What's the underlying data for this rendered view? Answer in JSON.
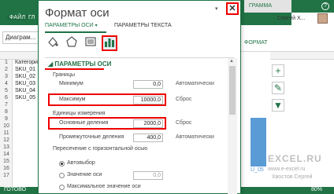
{
  "excel": {
    "file_tab": "ФАЙЛ",
    "home_tab_fragment": "ГЛ",
    "context_tab_fragment": "ГРАММА",
    "format_tab": "ФОРМАТ",
    "user_name": "Сергей Х...",
    "name_box": "Диаграм...",
    "rows": [
      "1",
      "2",
      "3",
      "4",
      "5",
      "6",
      "7",
      "8",
      "9",
      "10",
      "11",
      "12",
      "13",
      "14",
      "15",
      "16",
      "17"
    ],
    "cells": [
      "Категория",
      "SKU_01",
      "SKU_02",
      "SKU_03",
      "SKU_04",
      "SKU_05"
    ],
    "chart_label_fragment": "U_05",
    "watermark": "EXCEL.RU",
    "watermark_url": "www.e-excel.ru",
    "watermark_name": "Хвостов Сергей",
    "zoom": "80%",
    "ready": "ГОТОВО"
  },
  "dialog": {
    "title": "Формат оси",
    "close_glyph": "✕",
    "tabs": [
      {
        "label": "ПАРАМЕТРЫ ОСИ",
        "active": true
      },
      {
        "label": "ПАРАМЕТРЫ ТЕКСТА",
        "active": false
      }
    ],
    "icons": [
      "fill-line-icon",
      "effects-icon",
      "size-properties-icon",
      "axis-options-icon"
    ],
    "section_title": "ПАРАМЕТРЫ ОСИ",
    "bounds_label": "Границы",
    "minimum": {
      "label": "Минимум",
      "value": "0,0",
      "mode": "Автоматически"
    },
    "maximum": {
      "label": "Максимум",
      "value": "10000,0",
      "mode": "Сброс"
    },
    "units_label": "Единицы измерения",
    "major": {
      "label": "Основные деления",
      "value": "2000,0",
      "mode": "Сброс"
    },
    "minor": {
      "label": "Промежуточные деления",
      "value": "400,0",
      "mode": "Автоматически"
    },
    "cross_label": "Пересечение с горизонтальной осью",
    "radio_auto": "Автовыбор",
    "radio_value": "Значение оси",
    "radio_value_input": "0,0",
    "radio_max": "Максимальное значение оси"
  },
  "colors": {
    "accent": "#217346",
    "highlight": "#e00000",
    "bar": "#5b9bd5"
  }
}
